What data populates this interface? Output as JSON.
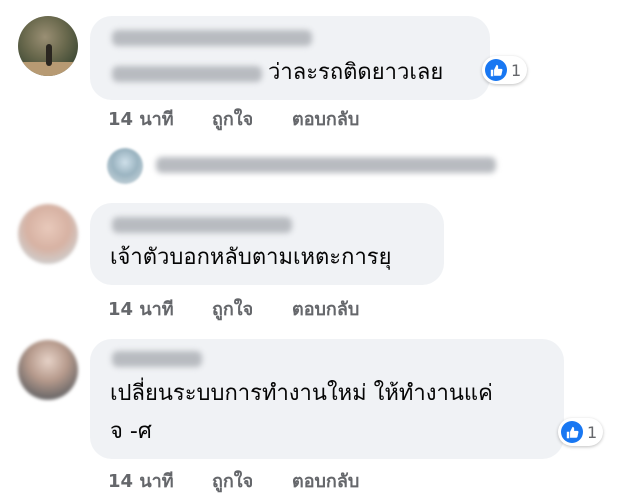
{
  "comments": [
    {
      "text_line1": "ว่าละรถติดยาวเลย",
      "reaction_count": "1"
    },
    {
      "text_line1": "เจ้าตัวบอกหลับตามเหตะการยุ"
    },
    {
      "text_line1": "เปลี่ยนระบบการทำงานใหม่ ให้ทำงานแค่",
      "text_line2": "จ -ศ",
      "reaction_count": "1"
    }
  ],
  "actions": {
    "time": "14 นาที",
    "like": "ถูกใจ",
    "reply": "ตอบกลับ"
  },
  "colors": {
    "bubble": "#f0f2f5",
    "like_blue": "#1877f2",
    "meta_grey": "#65676b"
  },
  "icons": {
    "reaction": "like-thumb-icon"
  }
}
